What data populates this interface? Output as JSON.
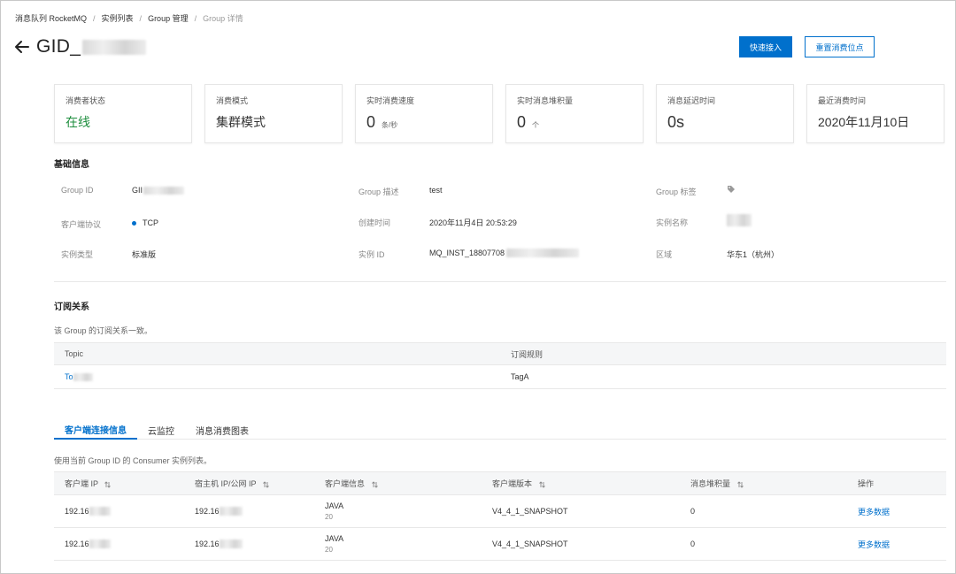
{
  "breadcrumb": [
    "消息队列 RocketMQ",
    "实例列表",
    "Group 管理",
    "Group 详情"
  ],
  "header": {
    "title": "GID_",
    "quick_access_label": "快速接入",
    "reset_offset_label": "重置消费位点"
  },
  "cards": [
    {
      "label": "消费者状态",
      "value": "在线",
      "unit": ""
    },
    {
      "label": "消费模式",
      "value": "集群模式",
      "unit": ""
    },
    {
      "label": "实时消费速度",
      "value": "0",
      "unit": "条/秒"
    },
    {
      "label": "实时消息堆积量",
      "value": "0",
      "unit": "个"
    },
    {
      "label": "消息延迟时间",
      "value": "0s",
      "unit": ""
    },
    {
      "label": "最近消费时间",
      "value": "2020年11月10日",
      "unit": ""
    }
  ],
  "basic_info": {
    "title": "基础信息",
    "group_id_label": "Group ID",
    "group_id_value": "GII",
    "group_desc_label": "Group 描述",
    "group_desc_value": "test",
    "group_tag_label": "Group 标签",
    "protocol_label": "客户端协议",
    "protocol_value": "TCP",
    "created_label": "创建时间",
    "created_value": "2020年11月4日 20:53:29",
    "instance_name_label": "实例名称",
    "instance_type_label": "实例类型",
    "instance_type_value": "标准版",
    "instance_id_label": "实例 ID",
    "instance_id_value": "MQ_INST_18807708",
    "region_label": "区域",
    "region_value": "华东1（杭州）"
  },
  "subscription": {
    "title": "订阅关系",
    "desc": "该 Group 的订阅关系一致。",
    "columns": [
      "Topic",
      "订阅规则"
    ],
    "rows": [
      {
        "topic": "To",
        "rule": "TagA"
      }
    ]
  },
  "tabs": [
    "客户端连接信息",
    "云监控",
    "消息消费图表"
  ],
  "client_table": {
    "desc": "使用当前 Group ID 的 Consumer 实例列表。",
    "columns": [
      "客户端 IP",
      "宿主机 IP/公网 IP",
      "客户端信息",
      "客户端版本",
      "消息堆积量",
      "操作"
    ],
    "rows": [
      {
        "ip": "192.16",
        "host_ip": "192.16",
        "lang": "JAVA",
        "lang_ver": "20",
        "version": "V4_4_1_SNAPSHOT",
        "backlog": "0",
        "action": "更多数据"
      },
      {
        "ip": "192.16",
        "host_ip": "192.16",
        "lang": "JAVA",
        "lang_ver": "20",
        "version": "V4_4_1_SNAPSHOT",
        "backlog": "0",
        "action": "更多数据"
      }
    ]
  },
  "colors": {
    "accent": "#0070cc",
    "online": "#1e8e3e"
  }
}
